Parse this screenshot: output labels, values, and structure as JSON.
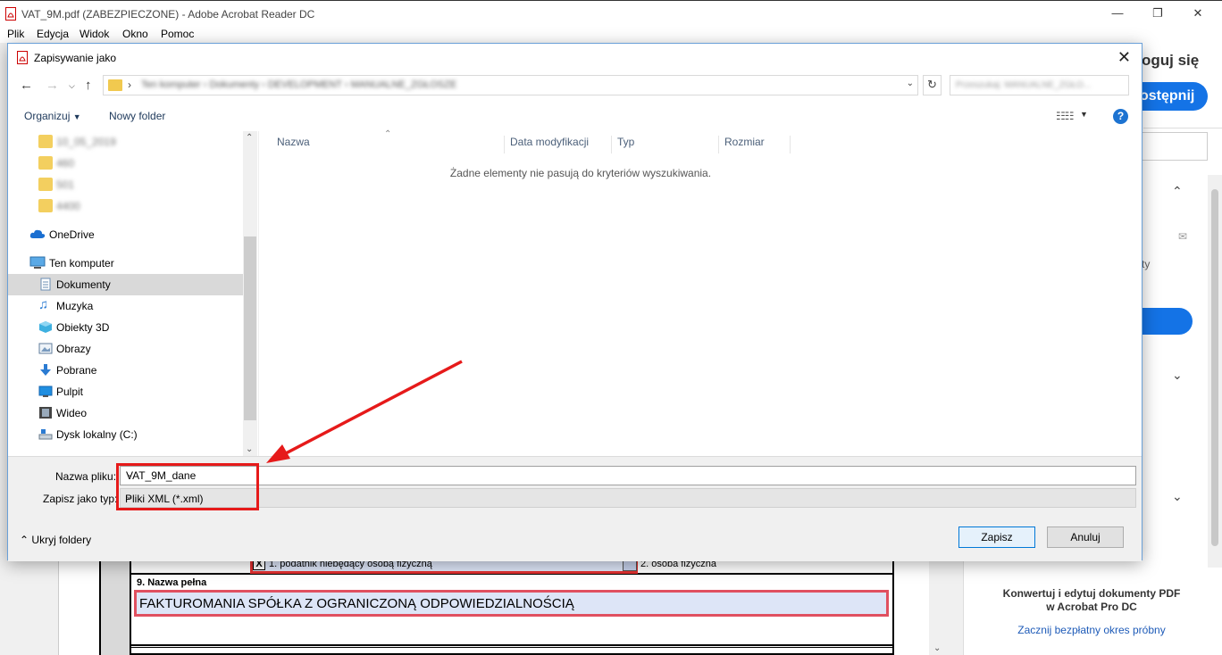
{
  "app": {
    "title": "VAT_9M.pdf (ZABEZPIECZONE) - Adobe Acrobat Reader DC",
    "menu": [
      "Plik",
      "Edycja",
      "Widok",
      "Okno",
      "Pomoc"
    ],
    "window_controls": [
      "minimize",
      "restore",
      "close"
    ],
    "right_panel": {
      "login": "oguj się",
      "share": "ostępnij",
      "partial_text": "ty",
      "promo_title_line1": "Konwertuj i edytuj dokumenty PDF",
      "promo_title_line2": "w Acrobat Pro DC",
      "promo_link": "Zacznij bezpłatny okres próbny"
    },
    "document": {
      "checkbox1_mark": "X",
      "checkbox1_label": "1. podatnik niebędący osobą fizyczną",
      "checkbox2_label": "2. osoba fizyczna",
      "field9_label": "9. Nazwa pełna",
      "field9_value": "FAKTUROMANIA SPÓŁKA Z OGRANICZONĄ ODPOWIEDZIALNOŚCIĄ"
    }
  },
  "dialog": {
    "title": "Zapisywanie jako",
    "breadcrumb": [
      "Ten komputer",
      "Dokumenty",
      "DEVELOPMENT",
      "MANUALNE_ZGŁOSZE"
    ],
    "search_placeholder": "Przeszukaj: MANUALNE_ZGŁO...",
    "toolbar": {
      "organize": "Organizuj",
      "new_folder": "Nowy folder"
    },
    "sidebar": {
      "blurred_folders": [
        "10_05_2019",
        "460",
        "501",
        "4400"
      ],
      "onedrive": "OneDrive",
      "this_pc": "Ten komputer",
      "items": [
        "Dokumenty",
        "Muzyka",
        "Obiekty 3D",
        "Obrazy",
        "Pobrane",
        "Pulpit",
        "Wideo",
        "Dysk lokalny (C:)"
      ],
      "selected": "Dokumenty"
    },
    "columns": [
      "Nazwa",
      "Data modyfikacji",
      "Typ",
      "Rozmiar"
    ],
    "empty_message": "Żadne elementy nie pasują do kryteriów wyszukiwania.",
    "filename_label": "Nazwa pliku:",
    "filename_value": "VAT_9M_dane",
    "filetype_label": "Zapisz jako typ:",
    "filetype_value": "Pliki XML (*.xml)",
    "hide_folders": "Ukryj foldery",
    "save_button": "Zapisz",
    "cancel_button": "Anuluj"
  },
  "colors": {
    "annotation_red": "#e61a1a",
    "acrobat_blue": "#1473e6",
    "selection_grey": "#d9d9d9",
    "help_blue": "#1d73d1"
  }
}
